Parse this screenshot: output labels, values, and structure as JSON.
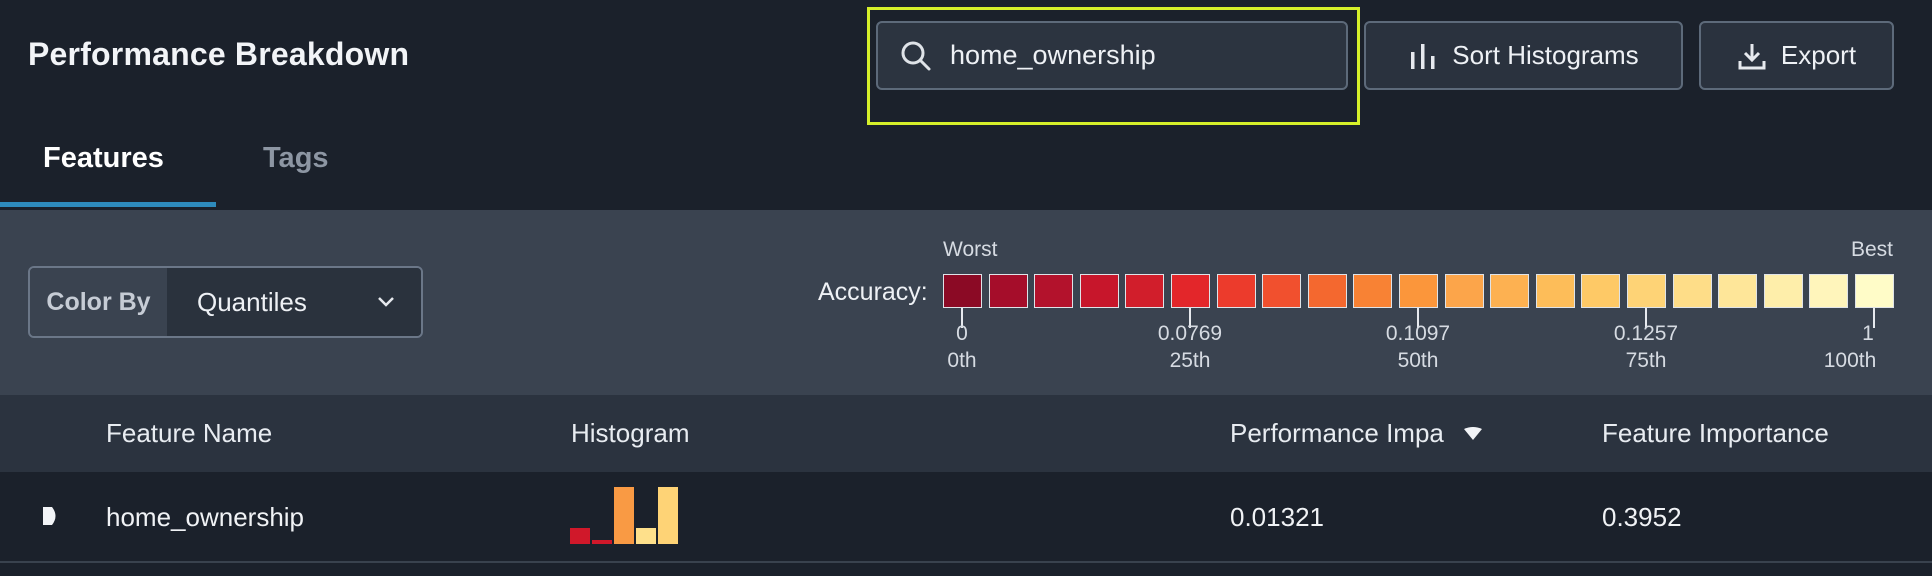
{
  "header": {
    "title": "Performance Breakdown",
    "search": {
      "value": "home_ownership",
      "icon": "search-icon"
    },
    "sort_button": {
      "label": "Sort Histograms",
      "icon": "bar-chart-icon"
    },
    "export_button": {
      "label": "Export",
      "icon": "download-icon"
    },
    "highlight_color": "#d6f02a"
  },
  "tabs": [
    {
      "label": "Features",
      "active": true
    },
    {
      "label": "Tags",
      "active": false
    }
  ],
  "color_by": {
    "label": "Color By",
    "selected": "Quantiles"
  },
  "legend": {
    "label": "Accuracy:",
    "worst": "Worst",
    "best": "Best",
    "swatches": [
      "#8b0a25",
      "#a50d2a",
      "#b3122c",
      "#c7162b",
      "#d11e2b",
      "#e3262a",
      "#ec3b2c",
      "#f1502e",
      "#f4682f",
      "#f88234",
      "#fb963b",
      "#fca54a",
      "#fdb151",
      "#fdbd59",
      "#fec966",
      "#fed376",
      "#fedd88",
      "#fee699",
      "#feeeaa",
      "#fff5bb",
      "#fffcc8"
    ],
    "ticks": [
      {
        "value": "0",
        "pct": "0th",
        "index": 0
      },
      {
        "value": "0.0769",
        "pct": "25th",
        "index": 5
      },
      {
        "value": "0.1097",
        "pct": "50th",
        "index": 10
      },
      {
        "value": "0.1257",
        "pct": "75th",
        "index": 15
      },
      {
        "value": "1",
        "pct": "100th",
        "index": 20
      }
    ]
  },
  "table": {
    "columns": {
      "name": "Feature Name",
      "histogram": "Histogram",
      "performance": "Performance Impa",
      "importance": "Feature Importance"
    },
    "rows": [
      {
        "name": "home_ownership",
        "performance": "0.01321",
        "importance": "0.3952",
        "histogram": [
          {
            "level": 0.27,
            "color": "#d0182a"
          },
          {
            "level": 0.07,
            "color": "#d0182a"
          },
          {
            "level": 0.98,
            "color": "#f99a44"
          },
          {
            "level": 0.27,
            "color": "#fee08b"
          },
          {
            "level": 0.98,
            "color": "#fed376"
          }
        ]
      }
    ]
  }
}
